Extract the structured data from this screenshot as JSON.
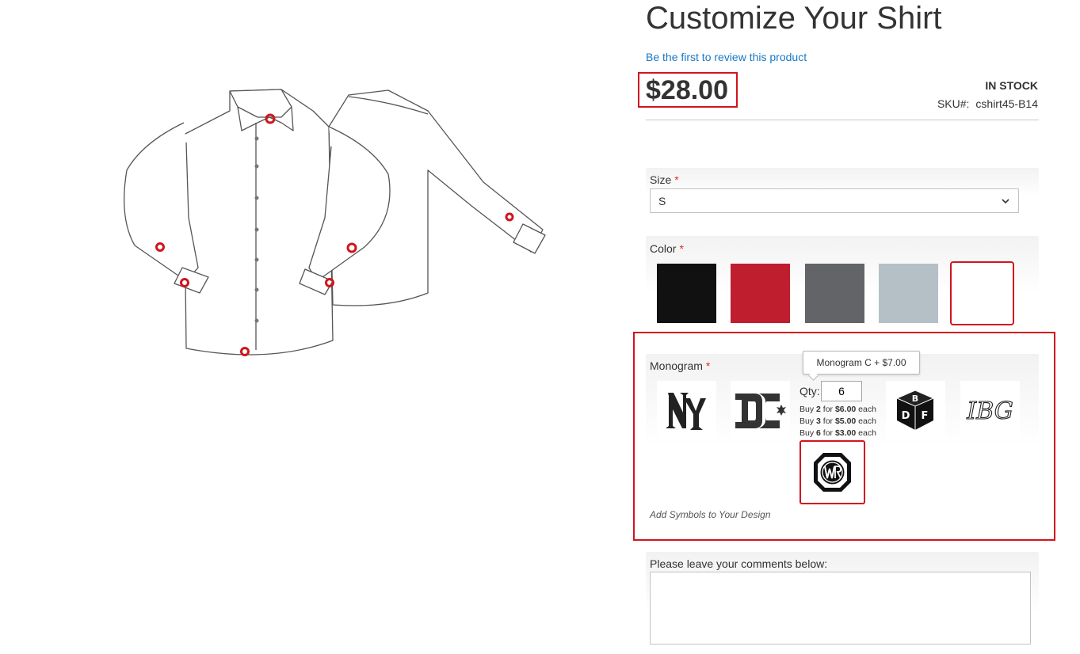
{
  "product": {
    "title": "Customize Your Shirt",
    "review_link": "Be the first to review this product",
    "price": "$28.00",
    "stock": "In stock",
    "sku_label": "SKU#:",
    "sku_value": "cshirt45-B14"
  },
  "options": {
    "size": {
      "label": "Size",
      "required_mark": "*",
      "selected": "S"
    },
    "color": {
      "label": "Color",
      "required_mark": "*",
      "swatches": [
        {
          "name": "black",
          "hex": "#111111"
        },
        {
          "name": "red",
          "hex": "#bf1e2e"
        },
        {
          "name": "dark-gray",
          "hex": "#636467"
        },
        {
          "name": "light-blue-gray",
          "hex": "#b4c0c6"
        },
        {
          "name": "white",
          "hex": "#ffffff",
          "selected": true
        }
      ]
    },
    "monogram": {
      "label": "Monogram",
      "required_mark": "*",
      "tooltip": "Monogram C + $7.00",
      "qty_label": "Qty:",
      "qty_value": "6",
      "tiers": [
        {
          "buy": "Buy",
          "qty": "2",
          "for": "for",
          "price": "$6.00",
          "each": "each"
        },
        {
          "buy": "Buy",
          "qty": "3",
          "for": "for",
          "price": "$5.00",
          "each": "each"
        },
        {
          "buy": "Buy",
          "qty": "6",
          "for": "for",
          "price": "$3.00",
          "each": "each"
        }
      ],
      "items": [
        {
          "name": "ny-logo"
        },
        {
          "name": "dc-logo"
        },
        {
          "name": "cwr-octagon-monogram",
          "selected": true
        },
        {
          "name": "bdf-block-monogram",
          "text": "BDF"
        },
        {
          "name": "script-monogram",
          "text": "IBG"
        }
      ],
      "hint": "Add Symbols to Your Design"
    },
    "comments": {
      "label": "Please leave your comments below:",
      "value": ""
    }
  },
  "colors": {
    "accent_red": "#d0151e",
    "link_blue": "#1979c3",
    "required_red": "#e02b27"
  }
}
